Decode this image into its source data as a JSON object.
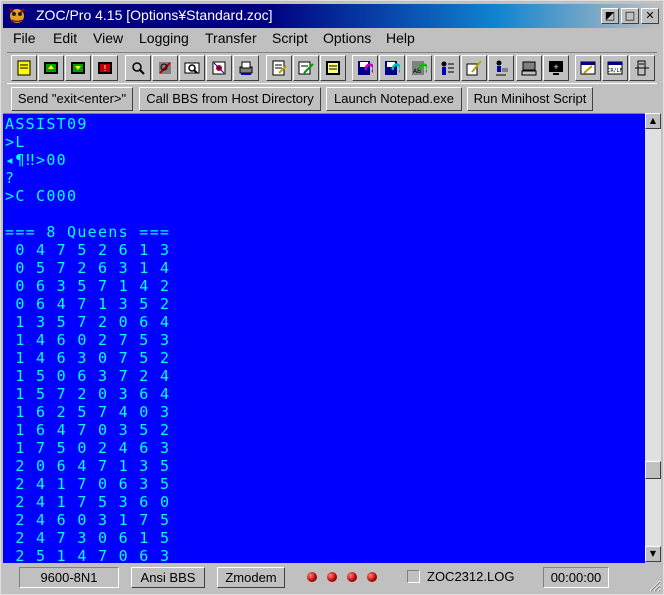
{
  "window": {
    "title": "ZOC/Pro 4.15 [Options¥Standard.zoc]"
  },
  "menu": [
    "File",
    "Edit",
    "View",
    "Logging",
    "Transfer",
    "Script",
    "Options",
    "Help"
  ],
  "toolbar_icons": [
    "phone-book-icon",
    "upload-icon",
    "download-icon",
    "hangup-icon",
    "search-icon",
    "tools-icon",
    "zoom-icon",
    "settings-icon",
    "printer-icon",
    "edit-sheet-icon",
    "chat-icon",
    "terminal-icon",
    "disk-save-icon",
    "disk-load-icon",
    "disk-ab-icon",
    "user-list-icon",
    "pencil-user-icon",
    "run-icon",
    "keyboard-icon",
    "monitor-icon",
    "notepad-icon",
    "clipboard-icon",
    "tower-icon"
  ],
  "buttons": [
    "Send \"exit<enter>\"",
    "Call BBS from Host Directory",
    "Launch Notepad.exe",
    "Run Minihost Script"
  ],
  "terminal": {
    "lines": [
      "ASSIST09",
      ">L",
      "◂¶‼>00",
      "?",
      ">C C000",
      "",
      "=== 8 Queens ===",
      " 0 4 7 5 2 6 1 3",
      " 0 5 7 2 6 3 1 4",
      " 0 6 3 5 7 1 4 2",
      " 0 6 4 7 1 3 5 2",
      " 1 3 5 7 2 0 6 4",
      " 1 4 6 0 2 7 5 3",
      " 1 4 6 3 0 7 5 2",
      " 1 5 0 6 3 7 2 4",
      " 1 5 7 2 0 3 6 4",
      " 1 6 2 5 7 4 0 3",
      " 1 6 4 7 0 3 5 2",
      " 1 7 5 0 2 4 6 3",
      " 2 0 6 4 7 1 3 5",
      " 2 4 1 7 0 6 3 5",
      " 2 4 1 7 5 3 6 0",
      " 2 4 6 0 3 1 7 5",
      " 2 4 7 3 0 6 1 5",
      " 2 5 1 4 7 0 6 3"
    ]
  },
  "status": {
    "baud": "9600-8N1",
    "emulation": "Ansi BBS",
    "protocol": "Zmodem",
    "log_file": "ZOC2312.LOG",
    "timer": "00:00:00"
  },
  "colors": {
    "terminal_bg": "#0000ff",
    "terminal_fg": "#00ffff",
    "title_bg": "#000080",
    "led": "#c00000"
  }
}
